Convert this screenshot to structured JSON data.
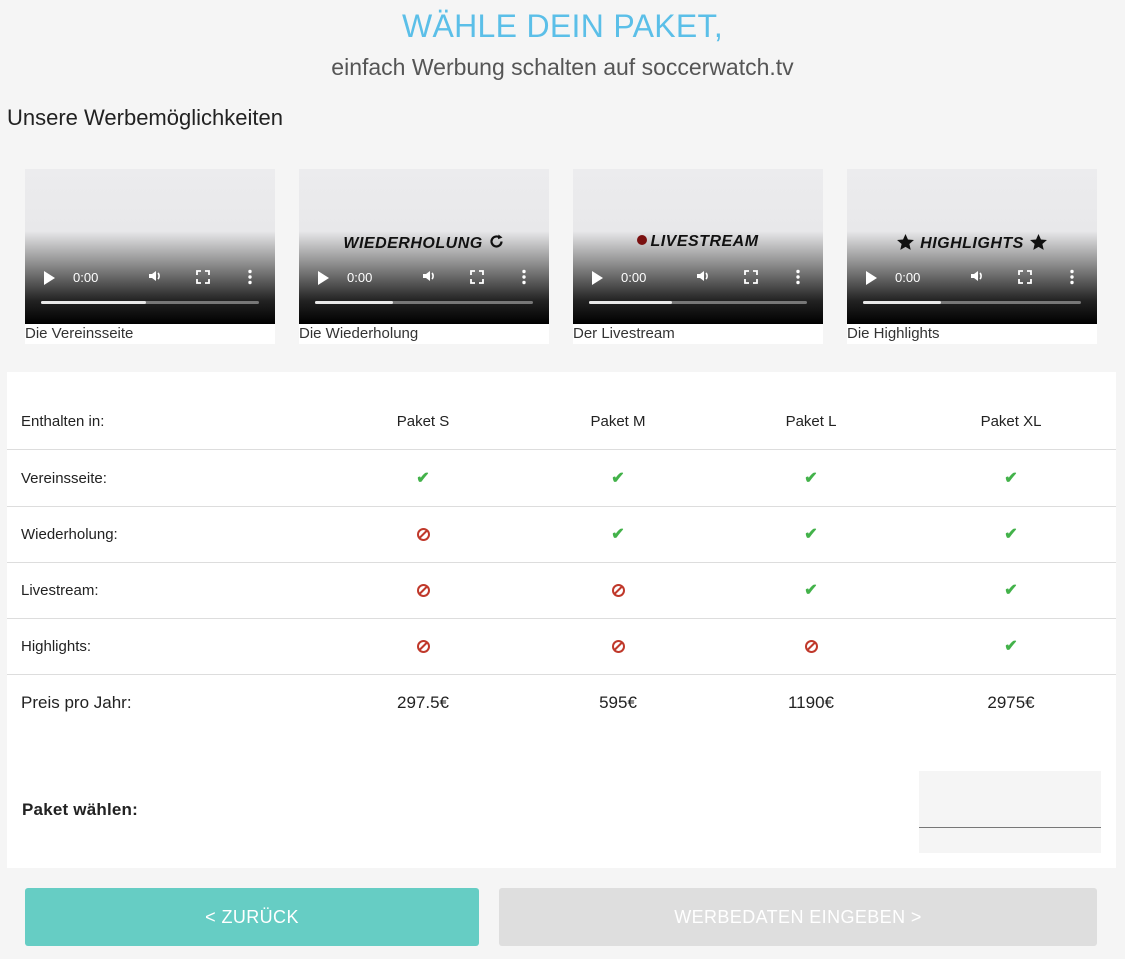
{
  "header": {
    "title": "WÄHLE DEIN PAKET,",
    "subtitle": "einfach Werbung schalten auf soccerwatch.tv"
  },
  "section": {
    "heading": "Unsere Werbemöglichkeiten"
  },
  "videos": [
    {
      "overlay": "",
      "time": "0:00",
      "caption": "Die Vereinsseite",
      "progress": 0.48
    },
    {
      "overlay": "WIEDERHOLUNG",
      "overlay_icon": "replay-icon",
      "time": "0:00",
      "caption": "Die Wiederholung",
      "progress": 0.36
    },
    {
      "overlay": "LIVESTREAM",
      "overlay_icon": "live-dot-icon",
      "time": "0:00",
      "caption": "Der Livestream",
      "progress": 0.38
    },
    {
      "overlay": "HIGHLIGHTS",
      "overlay_icon": "star-icon",
      "time": "0:00",
      "caption": "Die Highlights",
      "progress": 0.36
    }
  ],
  "table": {
    "header_label": "Enthalten in:",
    "packages": [
      "Paket S",
      "Paket M",
      "Paket L",
      "Paket XL"
    ],
    "rows": [
      {
        "label": "Vereinsseite:",
        "included": [
          true,
          true,
          true,
          true
        ]
      },
      {
        "label": "Wiederholung:",
        "included": [
          false,
          true,
          true,
          true
        ]
      },
      {
        "label": "Livestream:",
        "included": [
          false,
          false,
          true,
          true
        ]
      },
      {
        "label": "Highlights:",
        "included": [
          false,
          false,
          false,
          true
        ]
      }
    ],
    "price_label": "Preis pro Jahr:",
    "prices": [
      "297.5€",
      "595€",
      "1190€",
      "2975€"
    ],
    "choose_label": "Paket wählen:",
    "select_value": ""
  },
  "buttons": {
    "back": "< ZURÜCK",
    "next": "WERBEDATEN EINGEBEN >"
  },
  "colors": {
    "title": "#5bbfe8",
    "check": "#43b24a",
    "not_included": "#c0392b",
    "back_button": "#66cdc4",
    "next_button_disabled": "#dedede"
  }
}
